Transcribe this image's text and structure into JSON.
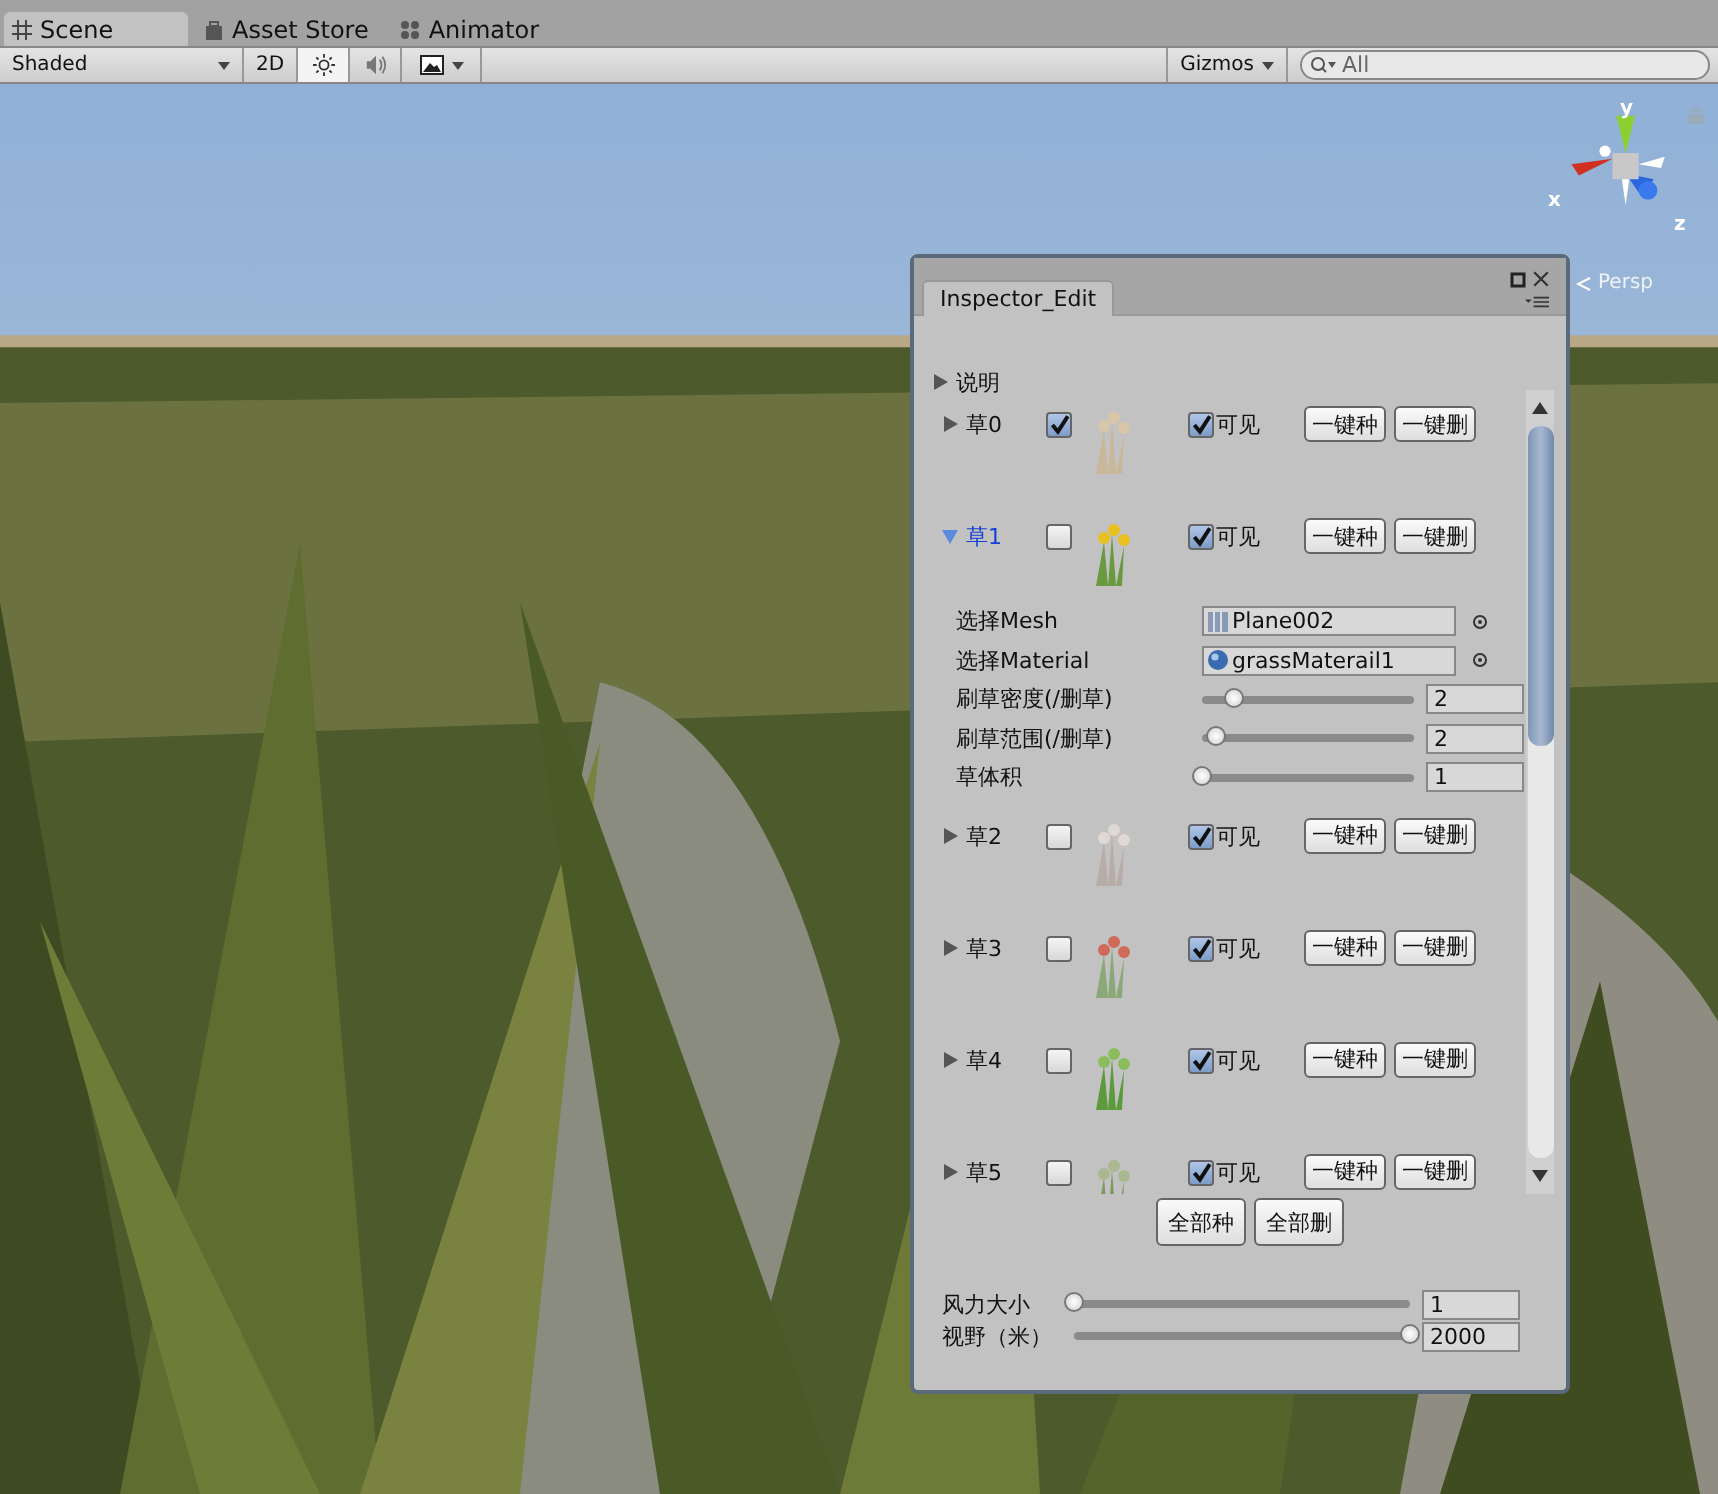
{
  "tabs": [
    {
      "label": "Scene",
      "selected": true
    },
    {
      "label": "Asset Store",
      "selected": false
    },
    {
      "label": "Animator",
      "selected": false
    }
  ],
  "toolbar": {
    "shading": "Shaded",
    "mode_2d": {
      "label": "2D",
      "on": false
    },
    "lighting_on": true,
    "audio_on": false,
    "gizmos": "Gizmos",
    "search": {
      "placeholder": "All"
    }
  },
  "scene": {
    "axis_labels": {
      "y": "y",
      "x": "x",
      "z": "z"
    },
    "projection": "Persp"
  },
  "inspector": {
    "title": "Inspector_Edit",
    "help": {
      "label": "说明",
      "expanded": false
    },
    "grasses": [
      {
        "label": "草0",
        "expanded": false,
        "checked": true,
        "visible": true,
        "visible_label": "可见",
        "plant_button": "一键种",
        "delete_button": "一键删"
      },
      {
        "label": "草1",
        "expanded": true,
        "checked": false,
        "visible": true,
        "visible_label": "可见",
        "plant_button": "一键种",
        "delete_button": "一键删",
        "settings": [
          {
            "kind": "object",
            "label": "选择Mesh",
            "value": "Plane002"
          },
          {
            "kind": "object",
            "label": "选择Material",
            "value": "grassMaterail1"
          },
          {
            "kind": "slider",
            "label": "刷草密度(/删草)",
            "level": 0.15,
            "value": "2"
          },
          {
            "kind": "slider",
            "label": "刷草范围(/删草)",
            "level": 0.07,
            "value": "2"
          },
          {
            "kind": "slider",
            "label": "草体积",
            "level": 0,
            "value": "1"
          }
        ]
      },
      {
        "label": "草2",
        "expanded": false,
        "checked": false,
        "visible": true,
        "visible_label": "可见",
        "plant_button": "一键种",
        "delete_button": "一键删"
      },
      {
        "label": "草3",
        "expanded": false,
        "checked": false,
        "visible": true,
        "visible_label": "可见",
        "plant_button": "一键种",
        "delete_button": "一键删"
      },
      {
        "label": "草4",
        "expanded": false,
        "checked": false,
        "visible": true,
        "visible_label": "可见",
        "plant_button": "一键种",
        "delete_button": "一键删"
      },
      {
        "label": "草5",
        "expanded": false,
        "checked": false,
        "visible": true,
        "visible_label": "可见",
        "plant_button": "一键种",
        "delete_button": "一键删"
      }
    ],
    "all_buttons": [
      "全部种",
      "全部删"
    ],
    "globals": [
      {
        "label": "风力大小",
        "level": 0,
        "value": "1"
      },
      {
        "label": "视野（米）",
        "level": 1,
        "value": "2000"
      }
    ]
  }
}
